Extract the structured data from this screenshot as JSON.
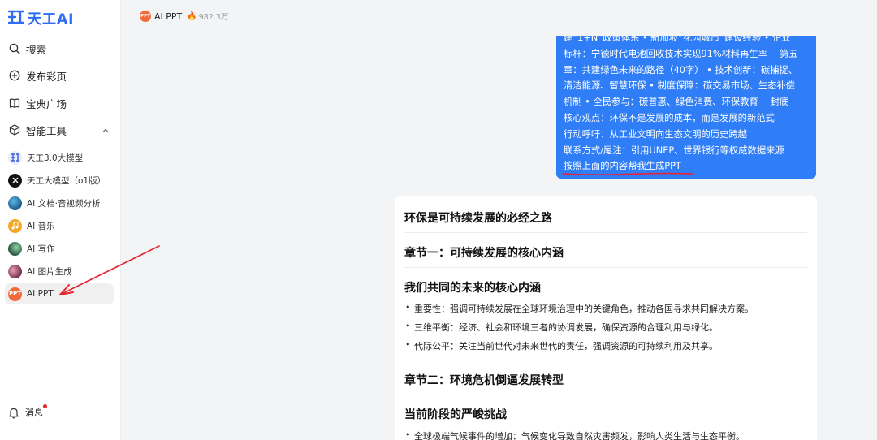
{
  "app": {
    "logo_text": "天工AI"
  },
  "sidebar": {
    "nav": [
      {
        "label": "搜索",
        "icon": "search-icon"
      },
      {
        "label": "发布彩页",
        "icon": "plus-circle-icon"
      },
      {
        "label": "宝典广场",
        "icon": "book-icon"
      },
      {
        "label": "智能工具",
        "icon": "cube-icon"
      }
    ],
    "tools": [
      {
        "label": "天工3.0大模型",
        "icon": "skywork-3-avatar",
        "color": "#3b5bdb"
      },
      {
        "label": "天工大模型（o1版）",
        "icon": "skywork-o1-avatar",
        "color": "#111111"
      },
      {
        "label": "AI 文档·音视频分析",
        "icon": "doc-analysis-avatar",
        "color": "#1b5e8a"
      },
      {
        "label": "AI 音乐",
        "icon": "music-avatar",
        "color": "#f5a623"
      },
      {
        "label": "AI 写作",
        "icon": "writing-avatar",
        "color": "#2d6a4f"
      },
      {
        "label": "AI 图片生成",
        "icon": "image-gen-avatar",
        "color": "#8e3b5c"
      },
      {
        "label": "AI PPT",
        "icon": "ppt-avatar",
        "color": "#f2693a"
      }
    ],
    "messages_label": "消息"
  },
  "header": {
    "title": "AI PPT",
    "badge_text": "PPT",
    "hot_icon": "fire-icon",
    "hot_count": "982.3万"
  },
  "user_message": {
    "lines": [
      "建“1+N”政策体系 • 新加坡“花园城市”建设经验 • 企业",
      "标杆：宁德时代电池回收技术实现91%材料再生率　 第五",
      "章：共建绿色未来的路径（40字） • 技术创新：碳捕捉、",
      "清洁能源、智慧环保 • 制度保障：碳交易市场、生态补偿",
      "机制 • 全民参与：碳普惠、绿色消费、环保教育　 封底",
      "核心观点：环保不是发展的成本，而是发展的新范式",
      "行动呼吁：从工业文明向生态文明的历史跨越",
      "联系方式/尾注：引用UNEP、世界银行等权威数据来源",
      "按照上面的内容帮我生成PPT"
    ]
  },
  "answer": {
    "title": "环保是可持续发展的必经之路",
    "section1": "章节一：可持续发展的核心内涵",
    "sub1": "我们共同的未来的核心内涵",
    "bullets1": [
      "重要性：强调可持续发展在全球环境治理中的关键角色，推动各国寻求共同解决方案。",
      "三维平衡：经济、社会和环境三者的协调发展，确保资源的合理利用与绿化。",
      "代际公平：关注当前世代对未来世代的责任，强调资源的可持续利用及共享。"
    ],
    "section2": "章节二：环境危机倒逼发展转型",
    "sub2": "当前阶段的严峻挑战",
    "bullets2": [
      "全球极端气候事件的增加：气候变化导致自然灾害频发，影响人类生活与生态平衡。"
    ]
  },
  "colors": {
    "brand": "#2f6cf6",
    "bubble": "#2f7df7",
    "annotation": "#e8232f"
  }
}
